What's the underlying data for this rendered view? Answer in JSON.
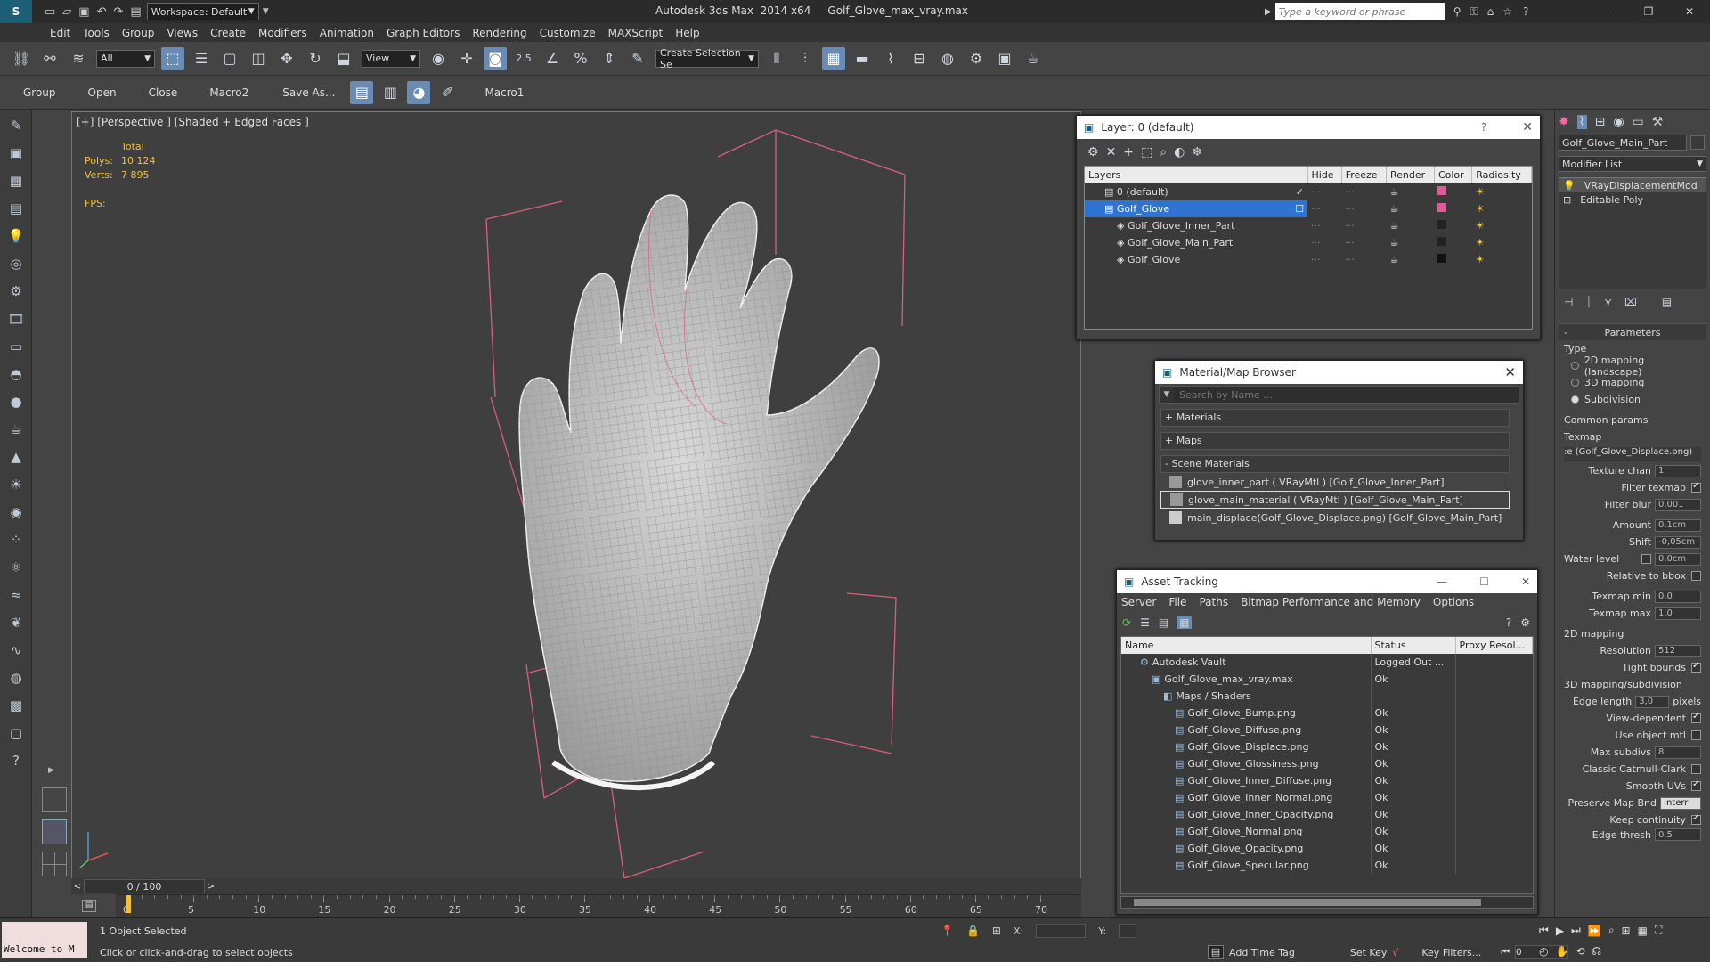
{
  "app": {
    "title": "Autodesk 3ds Max  2014 x64     Golf_Glove_max_vray.max",
    "workspace": "Workspace: Default",
    "search_placeholder": "Type a keyword or phrase"
  },
  "menu": [
    "Edit",
    "Tools",
    "Group",
    "Views",
    "Create",
    "Modifiers",
    "Animation",
    "Graph Editors",
    "Rendering",
    "Customize",
    "MAXScript",
    "Help"
  ],
  "toolbar1": {
    "filter": "All",
    "view": "View",
    "num": "2.5",
    "selection_set": "Create Selection Se"
  },
  "toolbar2": {
    "items": [
      "Group",
      "Open",
      "Close",
      "Macro2",
      "Save As...",
      "Macro1"
    ]
  },
  "viewport": {
    "label": "[+] [Perspective ] [Shaded + Edged Faces ]",
    "total_label": "Total",
    "polys_label": "Polys:",
    "polys": "10 124",
    "verts_label": "Verts:",
    "verts": "7 895",
    "fps_label": "FPS:"
  },
  "layer_panel": {
    "title": "Layer: 0 (default)",
    "help": "?",
    "columns": [
      "Layers",
      "Hide",
      "Freeze",
      "Render",
      "Color",
      "Radiosity"
    ],
    "rows": [
      {
        "name": "0 (default)",
        "color": "#e05a9a",
        "checked": true
      },
      {
        "name": "Golf_Glove",
        "color": "#e05a9a",
        "selected": true
      },
      {
        "name": "Golf_Glove_Inner_Part",
        "color": "#222222"
      },
      {
        "name": "Golf_Glove_Main_Part",
        "color": "#222222"
      },
      {
        "name": "Golf_Glove",
        "color": "#111111"
      }
    ]
  },
  "material_browser": {
    "title": "Material/Map Browser",
    "search_placeholder": "Search by Name ...",
    "groups": [
      "+ Materials",
      "+ Maps",
      "- Scene Materials"
    ],
    "items": [
      "glove_inner_part  ( VRayMtl ) [Golf_Glove_Inner_Part]",
      "glove_main_material  ( VRayMtl ) [Golf_Glove_Main_Part]",
      "main_displace(Golf_Glove_Displace.png) [Golf_Glove_Main_Part]"
    ]
  },
  "asset_tracking": {
    "title": "Asset Tracking",
    "menu": [
      "Server",
      "File",
      "Paths",
      "Bitmap Performance and Memory",
      "Options"
    ],
    "columns": [
      "Name",
      "Status",
      "Proxy Resol..."
    ],
    "rows": [
      {
        "name": "Autodesk Vault",
        "status": "Logged Out ...",
        "indent": 1
      },
      {
        "name": "Golf_Glove_max_vray.max",
        "status": "Ok",
        "indent": 2
      },
      {
        "name": "Maps / Shaders",
        "status": "",
        "indent": 3
      },
      {
        "name": "Golf_Glove_Bump.png",
        "status": "Ok",
        "indent": 4
      },
      {
        "name": "Golf_Glove_Diffuse.png",
        "status": "Ok",
        "indent": 4
      },
      {
        "name": "Golf_Glove_Displace.png",
        "status": "Ok",
        "indent": 4
      },
      {
        "name": "Golf_Glove_Glossiness.png",
        "status": "Ok",
        "indent": 4
      },
      {
        "name": "Golf_Glove_Inner_Diffuse.png",
        "status": "Ok",
        "indent": 4
      },
      {
        "name": "Golf_Glove_Inner_Normal.png",
        "status": "Ok",
        "indent": 4
      },
      {
        "name": "Golf_Glove_Inner_Opacity.png",
        "status": "Ok",
        "indent": 4
      },
      {
        "name": "Golf_Glove_Normal.png",
        "status": "Ok",
        "indent": 4
      },
      {
        "name": "Golf_Glove_Opacity.png",
        "status": "Ok",
        "indent": 4
      },
      {
        "name": "Golf_Glove_Specular.png",
        "status": "Ok",
        "indent": 4
      }
    ]
  },
  "command_panel": {
    "object_name": "Golf_Glove_Main_Part",
    "modifier_list": "Modifier List",
    "stack": [
      "VRayDisplacementMod",
      "Editable Poly"
    ],
    "parameters": "Parameters",
    "type_label": "Type",
    "types": [
      "2D mapping (landscape)",
      "3D mapping",
      "Subdivision"
    ],
    "common_params": "Common params",
    "texmap_label": "Texmap",
    "texmap_value": ":e (Golf_Glove_Displace.png)",
    "texture_chan_label": "Texture chan",
    "texture_chan": "1",
    "filter_texmap": "Filter texmap",
    "filter_blur_label": "Filter blur",
    "filter_blur": "0,001",
    "amount_label": "Amount",
    "amount": "0,1cm",
    "shift_label": "Shift",
    "shift": "-0,05cm",
    "water_level_label": "Water level",
    "water_level": "0,0cm",
    "relative_bbox": "Relative to bbox",
    "texmap_min_label": "Texmap min",
    "texmap_min": "0,0",
    "texmap_max_label": "Texmap max",
    "texmap_max": "1,0",
    "mapping2d": "2D mapping",
    "resolution_label": "Resolution",
    "resolution": "512",
    "tight_bounds": "Tight bounds",
    "mapping3d": "3D mapping/subdivision",
    "edge_length_label": "Edge length",
    "edge_length": "3,0",
    "pixels": "pixels",
    "view_dependent": "View-dependent",
    "use_object_mtl": "Use object mtl",
    "max_subdivs_label": "Max subdivs",
    "max_subdivs": "8",
    "classic_catmull": "Classic Catmull-Clark",
    "smooth_uvs": "Smooth UVs",
    "preserve_map_bnd_label": "Preserve Map Bnd",
    "preserve_map_bnd": "Interr",
    "keep_continuity": "Keep continuity",
    "edge_thresh_label": "Edge thresh",
    "edge_thresh": "0,5"
  },
  "timeline": {
    "frame": "0 / 100",
    "ticks": [
      "0",
      "5",
      "10",
      "15",
      "20",
      "25",
      "30",
      "35",
      "40",
      "45",
      "50",
      "55",
      "60",
      "65",
      "70"
    ]
  },
  "status": {
    "maxscript": "Welcome to M",
    "selected": "1 Object Selected",
    "hint": "Click or click-and-drag to select objects",
    "x_label": "X:",
    "y_label": "Y:",
    "add_time_tag": "Add Time Tag",
    "set_key": "Set Key",
    "key_filters": "Key Filters...",
    "frame_field": "0"
  }
}
